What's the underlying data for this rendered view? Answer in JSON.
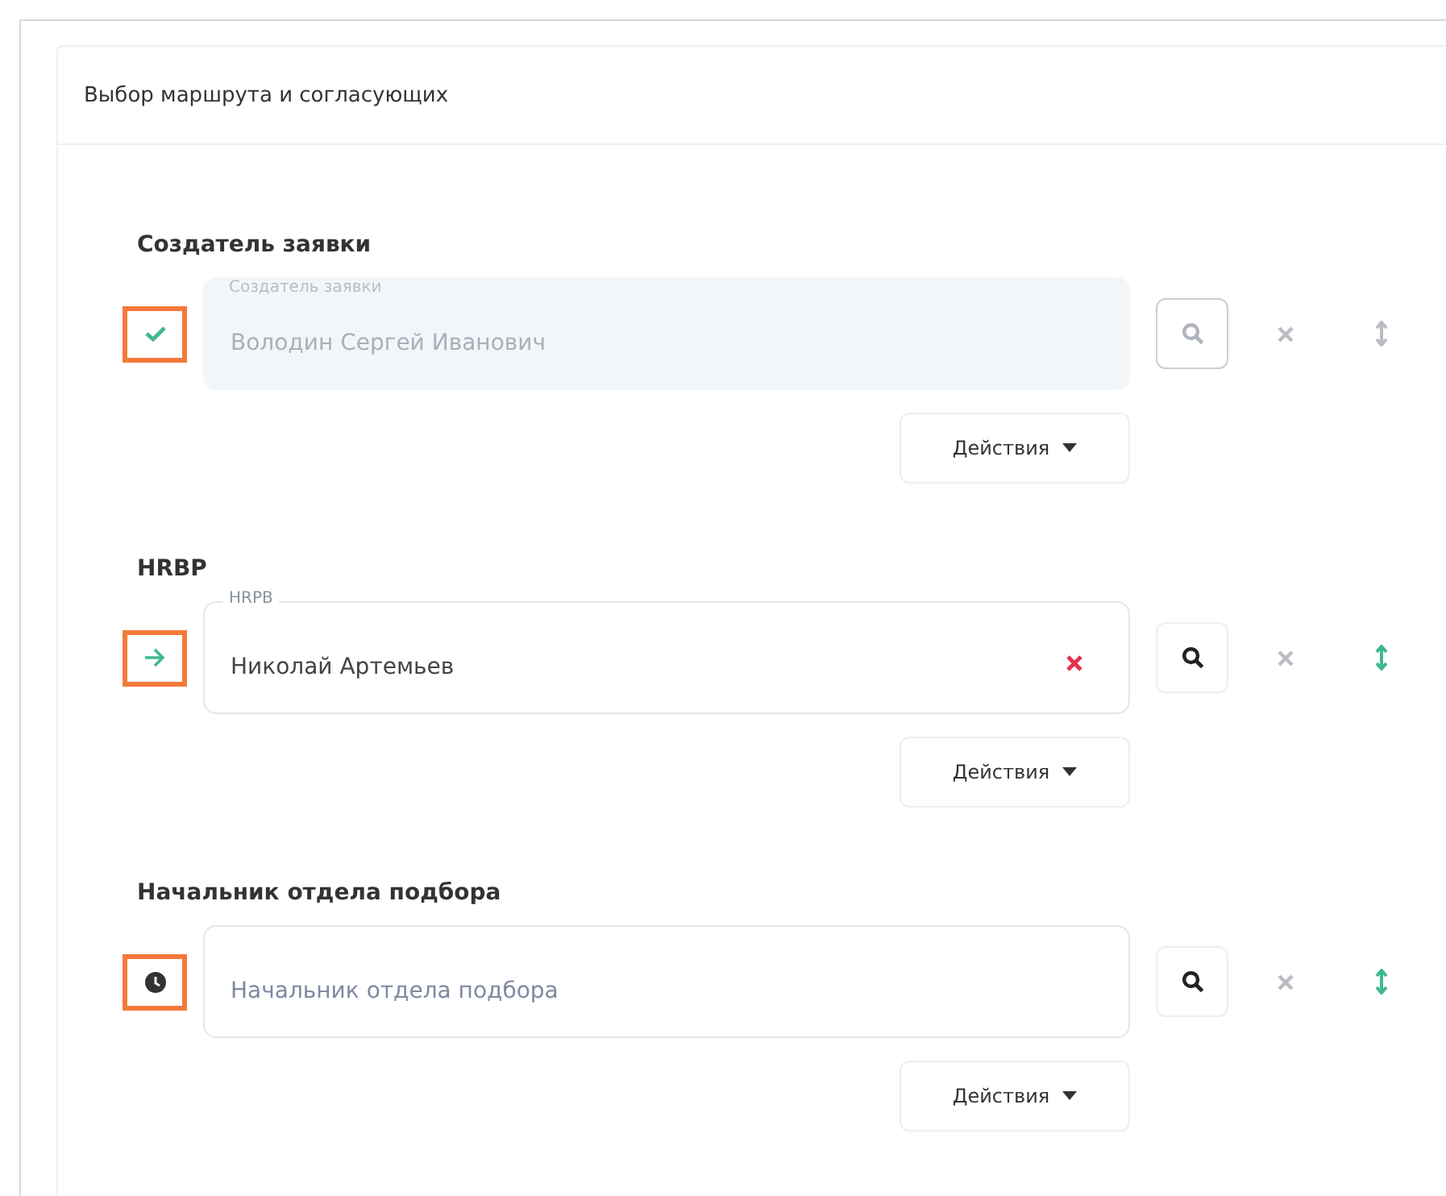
{
  "panel": {
    "title": "Выбор маршрута и согласующих"
  },
  "stages": [
    {
      "title": "Создатель заявки",
      "kind": "done",
      "highlighted": true,
      "field": {
        "label": "Создатель заявки",
        "value": "Володин Сергей Иванович",
        "disabled": true,
        "clearable": false
      },
      "search_disabled": true,
      "move_enabled": false,
      "actions": "Действия"
    },
    {
      "title": "HRBP",
      "kind": "current",
      "highlighted": true,
      "field": {
        "label": "HRPB",
        "value": "Николай Артемьев",
        "disabled": false,
        "clearable": true
      },
      "search_disabled": false,
      "move_enabled": true,
      "actions": "Действия"
    },
    {
      "title": "Начальник отдела подбора",
      "kind": "waiting",
      "highlighted": true,
      "field": {
        "placeholder": "Начальник отдела подбора",
        "disabled": false,
        "clearable": false
      },
      "search_disabled": false,
      "move_enabled": true,
      "actions": "Действия"
    }
  ]
}
